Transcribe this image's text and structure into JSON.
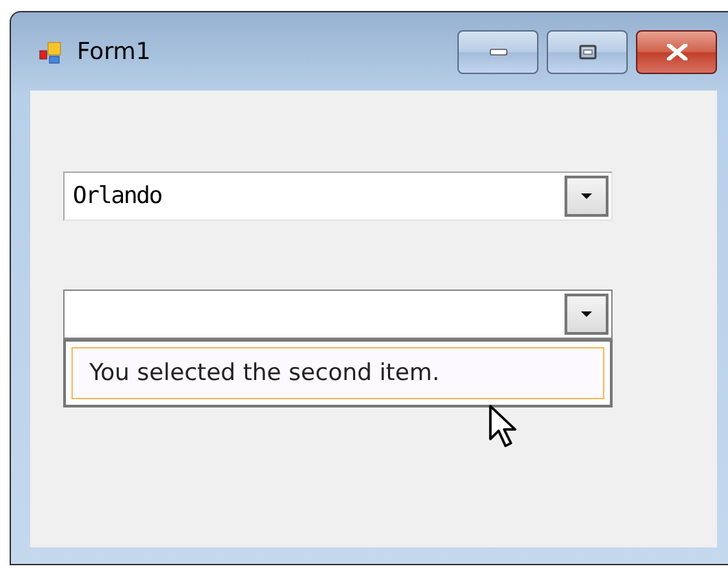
{
  "window": {
    "title": "Form1"
  },
  "combos": [
    {
      "value": "Orlando",
      "expanded": false
    },
    {
      "expanded": true,
      "items": [
        {
          "label": "You selected the second item.",
          "selected": true
        }
      ]
    }
  ]
}
